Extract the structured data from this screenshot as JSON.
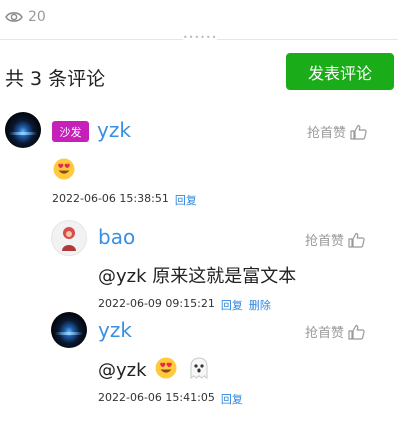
{
  "stats": {
    "views_icon": "eye-icon",
    "views_count": "20"
  },
  "comments_header": {
    "count_text": "共 3 条评论",
    "publish_label": "发表评论",
    "accent_color": "#1aad19"
  },
  "comments": [
    {
      "username": "yzk",
      "badge": "沙发",
      "like_label": "抢首赞",
      "content_text": "",
      "emojis": [
        "smiling-face-with-heart-eyes"
      ],
      "timestamp": "2022-06-06 15:38:51",
      "actions": [
        "回复"
      ]
    },
    {
      "username": "bao",
      "like_label": "抢首赞",
      "content_text": "@yzk 原来这就是富文本",
      "emojis": [],
      "timestamp": "2022-06-09 09:15:21",
      "actions": [
        "回复",
        "删除"
      ]
    },
    {
      "username": "yzk",
      "like_label": "抢首赞",
      "content_text": "@yzk",
      "emojis": [
        "smiling-face-with-heart-eyes",
        "ghost"
      ],
      "timestamp": "2022-06-06 15:41:05",
      "actions": [
        "回复"
      ]
    }
  ],
  "colors": {
    "username": "#3a8fe0",
    "badge": "#c520ba",
    "link": "#2e86de"
  }
}
